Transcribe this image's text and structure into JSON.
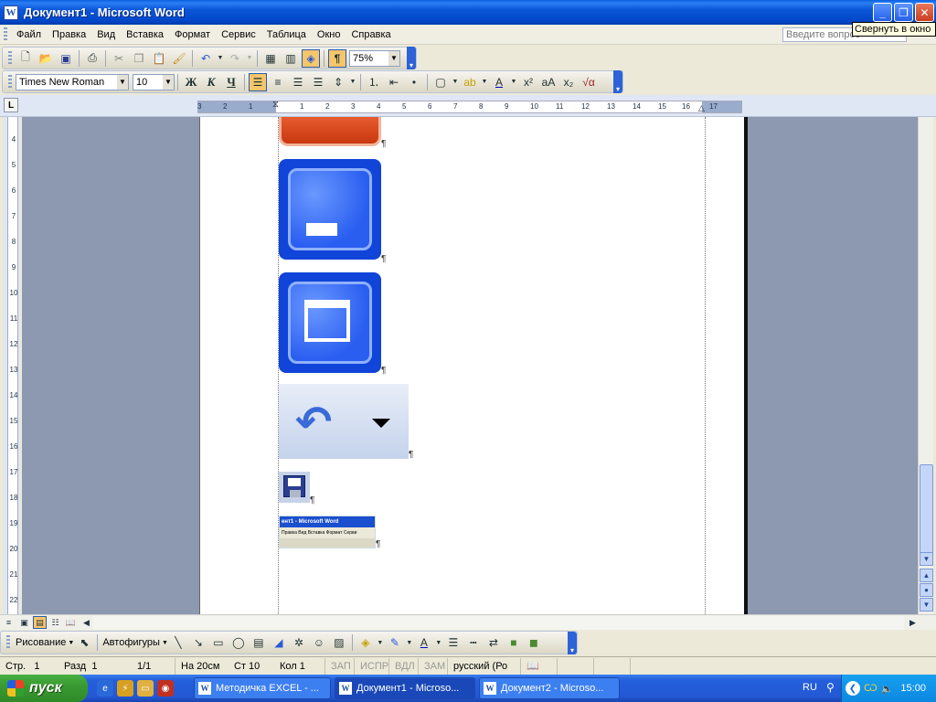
{
  "window": {
    "title": "Документ1 - Microsoft Word",
    "tooltip": "Свернуть в окно"
  },
  "menu": {
    "items": [
      "Файл",
      "Правка",
      "Вид",
      "Вставка",
      "Формат",
      "Сервис",
      "Таблица",
      "Окно",
      "Справка"
    ],
    "help_placeholder": "Введите вопрос"
  },
  "standard_toolbar": {
    "zoom": "75%",
    "icons": [
      "new-document-icon",
      "open-folder-icon",
      "save-icon",
      "print-icon",
      "cut-icon",
      "copy-icon",
      "paste-icon",
      "format-painter-icon",
      "undo-icon",
      "redo-icon",
      "insert-table-icon",
      "columns-icon",
      "drawing-icon",
      "show-formatting-icon"
    ]
  },
  "formatting_toolbar": {
    "font": "Times New Roman",
    "size": "10",
    "bold": "Ж",
    "italic": "К",
    "underline": "Ч"
  },
  "ruler": {
    "h_numbers": [
      "3",
      "2",
      "1",
      "1",
      "2",
      "3",
      "4",
      "5",
      "6",
      "7",
      "8",
      "9",
      "10",
      "11",
      "12",
      "13",
      "14",
      "15",
      "16",
      "17"
    ],
    "v_numbers": [
      "4",
      "5",
      "6",
      "7",
      "8",
      "9",
      "10",
      "11",
      "12",
      "13",
      "14",
      "15",
      "16",
      "17",
      "18",
      "19",
      "20",
      "21",
      "22"
    ]
  },
  "document": {
    "embedded_image_title": "ент1 - Microsoft Word",
    "embedded_image_menu": "Правка  Вид  Вставка  Формат  Серви",
    "pilcrow": "¶"
  },
  "drawing_toolbar": {
    "draw_label": "Рисование",
    "autoshapes_label": "Автофигуры"
  },
  "status": {
    "page": "Стр.",
    "page_num": "1",
    "section": "Разд",
    "section_num": "1",
    "pages": "1/1",
    "at": "На 20см",
    "line": "Ст 10",
    "col": "Кол 1",
    "rec": "ЗАП",
    "trk": "ИСПР",
    "ext": "ВДЛ",
    "ovr": "ЗАМ",
    "language": "русский (Ро"
  },
  "taskbar": {
    "start": "пуск",
    "tasks": [
      "Методичка EXCEL - ...",
      "Документ1 - Microso...",
      "Документ2 - Microso..."
    ],
    "lang": "RU",
    "clock": "15:00"
  }
}
